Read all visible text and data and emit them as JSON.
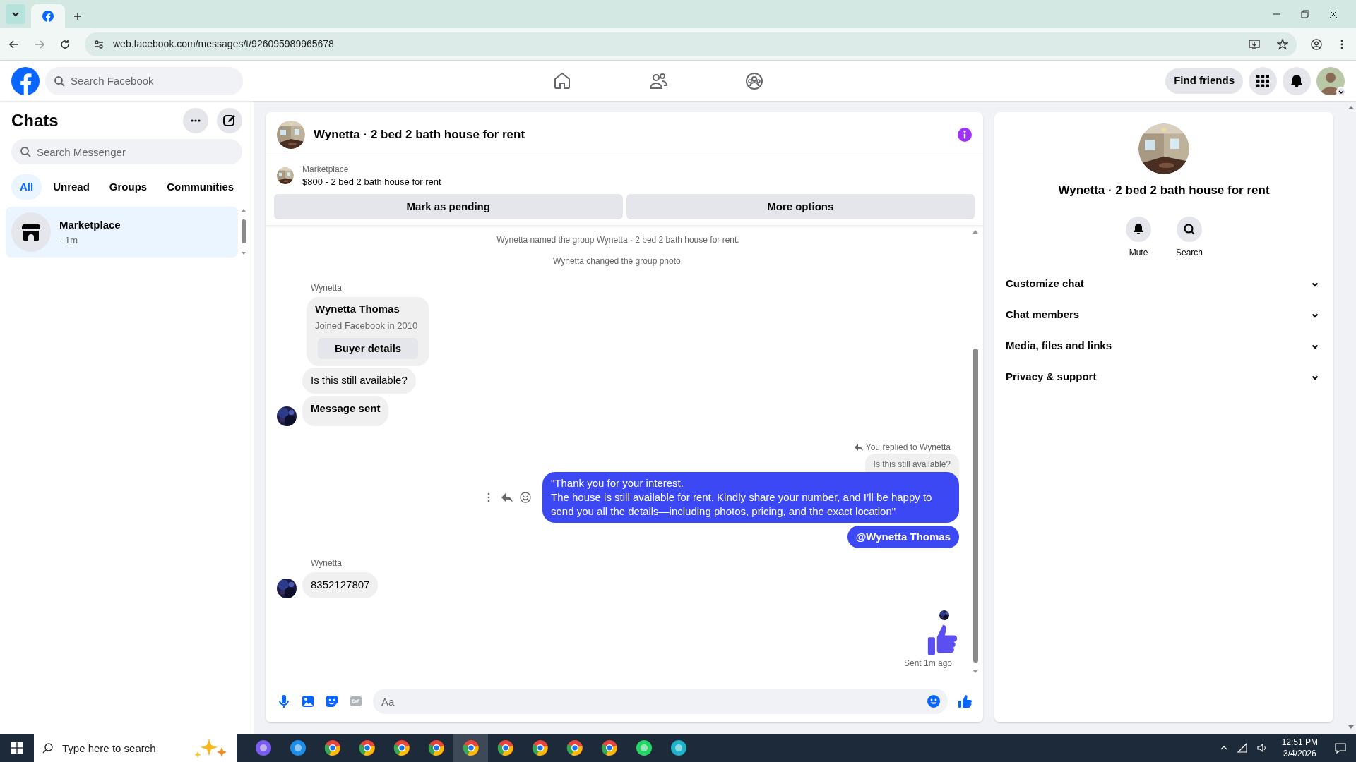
{
  "browser": {
    "tabs": [
      {
        "selected": true
      }
    ],
    "url": "web.facebook.com/messages/t/926095989965678"
  },
  "top_nav": {
    "search_placeholder": "Search Facebook",
    "nav_items": [
      {
        "kind": "home",
        "selected": false
      },
      {
        "kind": "friends",
        "selected": false
      },
      {
        "kind": "groups",
        "selected": false
      }
    ],
    "find_friends": "Find friends"
  },
  "sidebar": {
    "title": "Chats",
    "search_placeholder": "Search Messenger",
    "filters": [
      {
        "label": "All",
        "selected": true
      },
      {
        "label": "Unread",
        "selected": false
      },
      {
        "label": "Groups",
        "selected": false
      },
      {
        "label": "Communities",
        "selected": false
      }
    ],
    "chats": [
      {
        "name": "Marketplace",
        "time": "· 1m",
        "selected": true
      }
    ]
  },
  "chat": {
    "title": "Wynetta · 2 bed 2 bath house for rent",
    "listing": {
      "source": "Marketplace",
      "text": "$800 - 2 bed 2 bath house for rent"
    },
    "actions": [
      "Mark as pending",
      "More options"
    ],
    "messages": [
      {
        "kind": "system",
        "text": "Wynetta named the group Wynetta · 2 bed 2 bath house for rent."
      },
      {
        "kind": "system",
        "text": "Wynetta changed the group photo."
      },
      {
        "kind": "sender",
        "text": "Wynetta"
      },
      {
        "kind": "card",
        "name": "Wynetta Thomas",
        "subtitle": "Joined Facebook in 2010",
        "button": "Buyer details"
      },
      {
        "kind": "incoming",
        "text": "Is this still available?",
        "bold": false,
        "avatar": false
      },
      {
        "kind": "incoming",
        "text": "Message sent",
        "bold": true,
        "avatar": true
      },
      {
        "kind": "reply_note",
        "text": "You replied to Wynetta"
      },
      {
        "kind": "quoted",
        "text": "Is this still available?"
      },
      {
        "kind": "outgoing",
        "text": "\"Thank you for your interest.\nThe house is still available for rent. Kindly share your number, and I’ll be happy to send you all the details—including photos, pricing, and the exact location\"",
        "bold": false,
        "hover_actions": true
      },
      {
        "kind": "outgoing",
        "text": "@Wynetta Thomas",
        "bold": true,
        "hover_actions": false
      },
      {
        "kind": "sender",
        "text": "Wynetta"
      },
      {
        "kind": "incoming",
        "text": "8352127807",
        "bold": false,
        "avatar": true
      },
      {
        "kind": "seen"
      },
      {
        "kind": "like"
      },
      {
        "kind": "status",
        "text": "Sent 1m ago"
      }
    ],
    "composer_placeholder": "Aa"
  },
  "details": {
    "title": "Wynetta · 2 bed 2 bath house for rent",
    "actions": [
      {
        "kind": "mute",
        "label": "Mute"
      },
      {
        "kind": "search",
        "label": "Search"
      }
    ],
    "sections": [
      "Customize chat",
      "Chat members",
      "Media, files and links",
      "Privacy & support"
    ]
  },
  "taskbar": {
    "search_placeholder": "Type here to search",
    "time": "12:51 PM",
    "date": "3/4/2026"
  }
}
